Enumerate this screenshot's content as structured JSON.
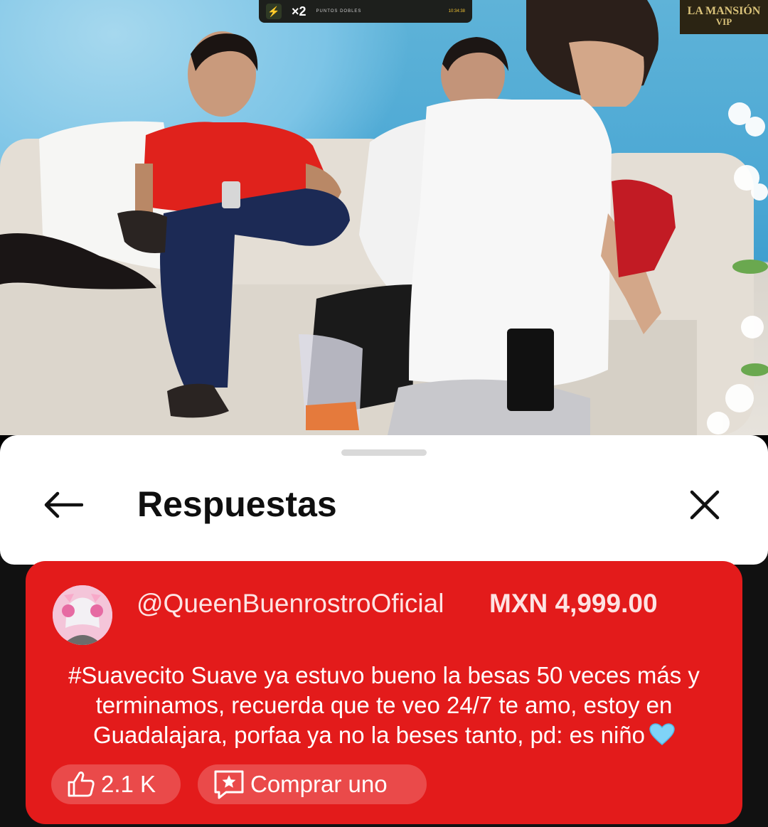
{
  "video": {
    "hud": {
      "multiplier": "×2",
      "label": "PUNTOS DOBLES",
      "time": "10:34:38"
    },
    "logo": {
      "line1": "LA MANSIÓN",
      "line2": "VIP"
    }
  },
  "panel": {
    "title": "Respuestas",
    "back_icon": "arrow-left-icon",
    "close_icon": "close-icon"
  },
  "super_chat": {
    "username": "@QueenBuenrostroOficial",
    "amount": "MXN 4,999.00",
    "message": "#Suavecito Suave ya estuvo bueno la besas 50 veces más y terminamos, recuerda que te veo 24/7 te amo, estoy en Guadalajara, porfaa ya no la beses tanto, pd: es niño",
    "emoji": "light-blue-heart",
    "likes": "2.1 K",
    "buy_label": "Comprar uno",
    "background_color": "#e31b1b"
  }
}
